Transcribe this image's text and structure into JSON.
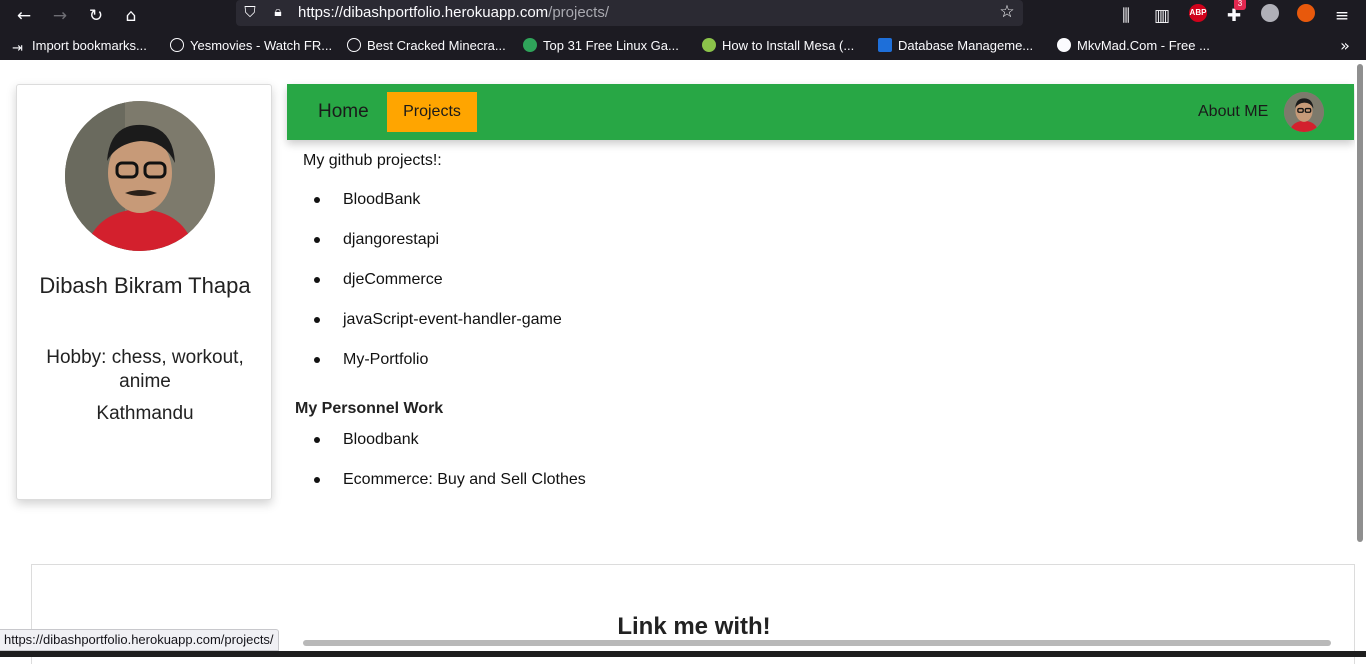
{
  "browser": {
    "url_host": "https://dibashportfolio.herokuapp.com",
    "url_path": "/projects/",
    "extensions": {
      "abp": "ABP",
      "badge_count": "3"
    },
    "bookmarks": [
      {
        "label": "Import bookmarks...",
        "icon": "import-icon",
        "color": "#fbfbfe"
      },
      {
        "label": "Yesmovies - Watch FR...",
        "icon": "globe-icon",
        "color": "#fbfbfe"
      },
      {
        "label": "Best Cracked Minecra...",
        "icon": "globe-icon",
        "color": "#fbfbfe"
      },
      {
        "label": "Top 31 Free Linux Ga...",
        "icon": "gear-icon",
        "color": "#2fa45a"
      },
      {
        "label": "How to Install Mesa (...",
        "icon": "site-icon",
        "color": "#8bc34a"
      },
      {
        "label": "Database Manageme...",
        "icon": "bct-icon",
        "color": "#1e6fd9"
      },
      {
        "label": "MkvMad.Com - Free ...",
        "icon": "play-icon",
        "color": "#fbfbfe"
      }
    ],
    "status_url": "https://dibashportfolio.herokuapp.com/projects/"
  },
  "profile": {
    "name": "Dibash Bikram Thapa",
    "hobby": "Hobby: chess, workout, anime",
    "city": "Kathmandu"
  },
  "nav": {
    "home": "Home",
    "projects": "Projects",
    "about": "About ME",
    "bar_color": "#28a745",
    "active_color": "#ffa500"
  },
  "github": {
    "heading": "My github projects!:",
    "projects": [
      "BloodBank",
      "djangorestapi",
      "djeCommerce",
      "javaScript-event-handler-game",
      "My-Portfolio"
    ]
  },
  "work": {
    "heading": "My Personnel Work",
    "items": [
      "Bloodbank",
      "Ecommerce: Buy and Sell Clothes"
    ]
  },
  "links": {
    "title": "Link me with!"
  }
}
